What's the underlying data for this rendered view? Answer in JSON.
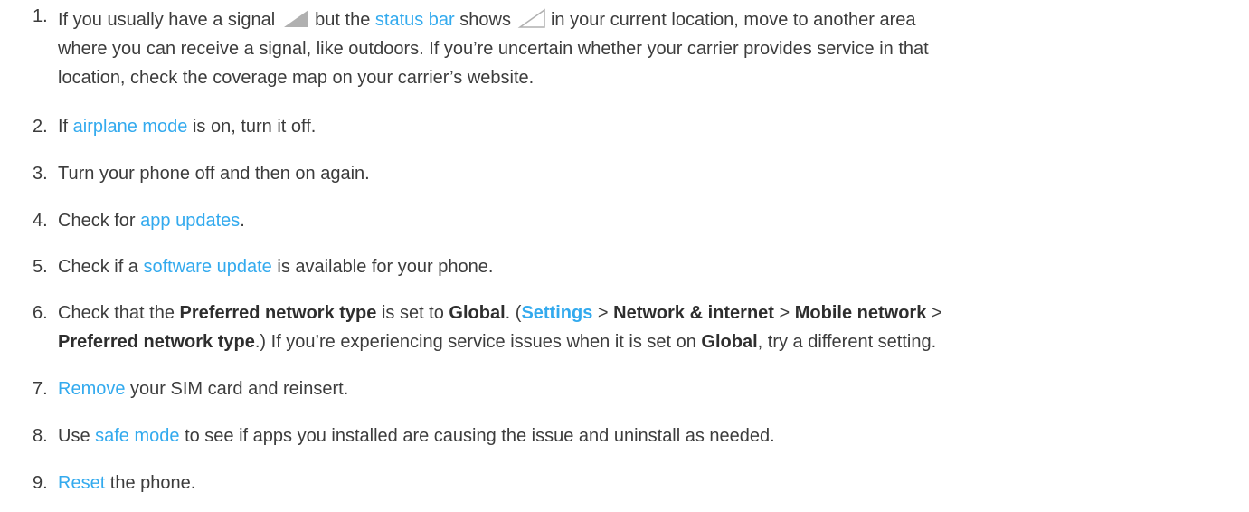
{
  "steps": [
    {
      "number": "1.",
      "lines": [
        {
          "t1": "If you usually have a signal",
          "t2": "but the",
          "link": "status bar",
          "t3": "shows",
          "t4": "in your current location, move to another area"
        },
        {
          "text": "where you can receive a signal, like outdoors. If you’re uncertain whether your carrier provides service in that"
        },
        {
          "text": "location, check the coverage map on your carrier’s website."
        }
      ]
    },
    {
      "number": "2.",
      "pre": "If ",
      "link": "airplane mode",
      "post": " is on, turn it off."
    },
    {
      "number": "3.",
      "text": "Turn your phone off and then on again."
    },
    {
      "number": "4.",
      "pre": "Check for ",
      "link": "app updates",
      "post": "."
    },
    {
      "number": "5.",
      "pre": "Check if a ",
      "link": "software update",
      "post": " is available for your phone."
    },
    {
      "number": "6.",
      "line1": {
        "a": "Check that the ",
        "b1": "Preferred network type",
        "c": " is set to ",
        "b2": "Global",
        "d": ". (",
        "link": "Settings",
        "e": " > ",
        "b3": "Network & internet",
        "f": " > ",
        "b4": "Mobile network",
        "g": " >"
      },
      "line2": {
        "b5": "Preferred network type",
        "a": ".) If you’re experiencing service issues when it is set on ",
        "b6": "Global",
        "c": ", try a different setting."
      }
    },
    {
      "number": "7.",
      "link": "Remove",
      "post": " your SIM card and reinsert."
    },
    {
      "number": "8.",
      "pre": "Use ",
      "link": "safe mode",
      "post": " to see if apps you installed are causing the issue and uninstall as needed."
    },
    {
      "number": "9.",
      "link": "Reset",
      "post": " the phone."
    }
  ],
  "icons": {
    "signal_full": "signal-full-icon",
    "signal_empty": "signal-empty-icon"
  },
  "colors": {
    "text": "#3c3c3c",
    "link": "#33aaee",
    "signal_fill": "#b0b0b0"
  }
}
